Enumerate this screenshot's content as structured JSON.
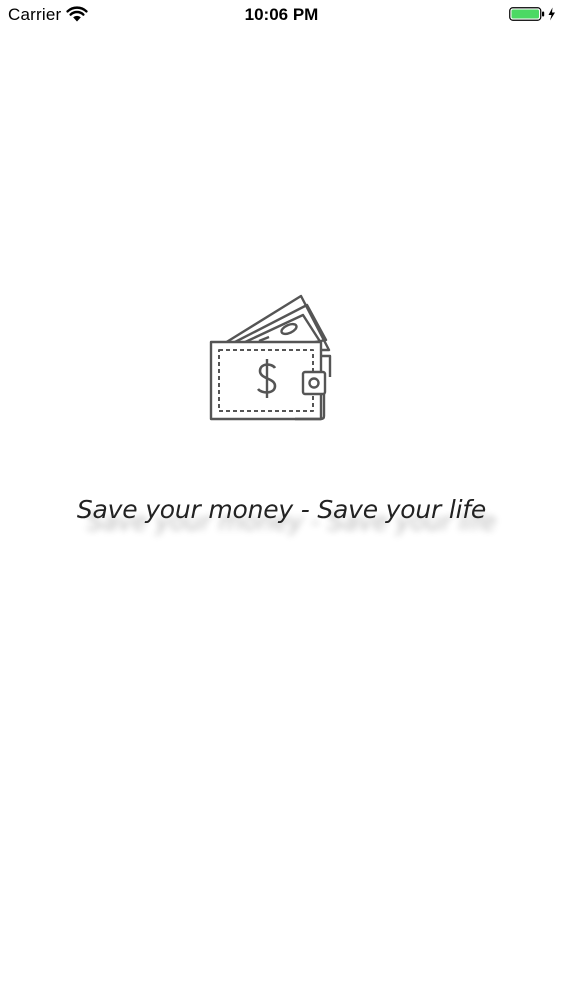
{
  "status_bar": {
    "carrier": "Carrier",
    "time": "10:06 PM",
    "wifi_icon": "wifi-icon",
    "battery_icon": "battery-charging-icon",
    "battery_color": "#4cd964"
  },
  "splash": {
    "logo_icon": "wallet-money-icon",
    "tagline": "Save your money - Save your life",
    "icon_color": "#555555"
  }
}
